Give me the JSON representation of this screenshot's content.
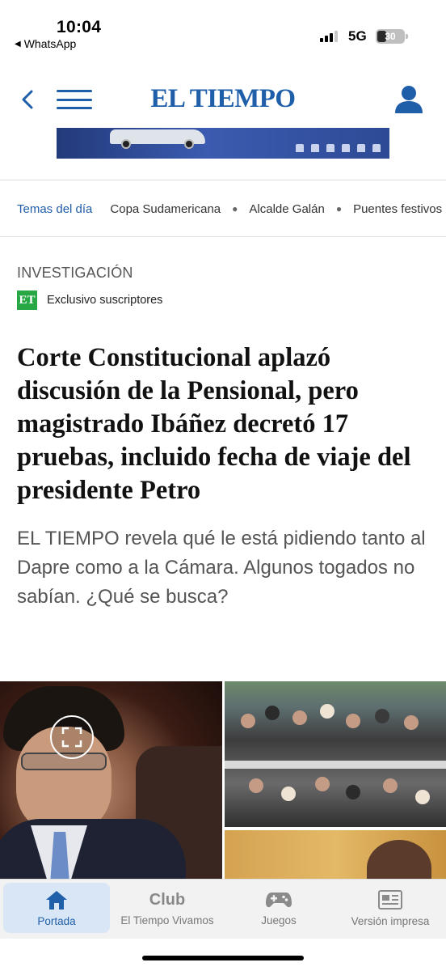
{
  "status_bar": {
    "time": "10:04",
    "back_app": "WhatsApp",
    "network": "5G",
    "battery": "30"
  },
  "header": {
    "brand": "EL TIEMPO"
  },
  "topics": {
    "lead": "Temas del día",
    "items": [
      "Copa Sudamericana",
      "Alcalde Galán",
      "Puentes festivos"
    ]
  },
  "article": {
    "section": "INVESTIGACIÓN",
    "badge": "ET",
    "exclusive": "Exclusivo suscriptores",
    "headline": "Corte Constitucional aplazó discusión de la Pensional, pero magistrado Ibáñez decretó 17 pruebas, incluido fecha de viaje del presidente Petro",
    "summary": "EL TIEMPO revela qué le está pidiendo tanto al Dapre como a la Cámara. Algunos togados no sabían. ¿Qué se busca?"
  },
  "bottom_nav": {
    "items": [
      {
        "label": "Portada",
        "icon": "home-icon",
        "active": true
      },
      {
        "label": "El Tiempo Vivamos",
        "icon": "club-icon",
        "active": false,
        "icon_text": "Club"
      },
      {
        "label": "Juegos",
        "icon": "gamepad-icon",
        "active": false
      },
      {
        "label": "Versión impresa",
        "icon": "newspaper-icon",
        "active": false
      }
    ]
  },
  "colors": {
    "brand_blue": "#1f5ea8",
    "badge_green": "#27a844",
    "nav_active_bg": "#d9e6f6"
  }
}
